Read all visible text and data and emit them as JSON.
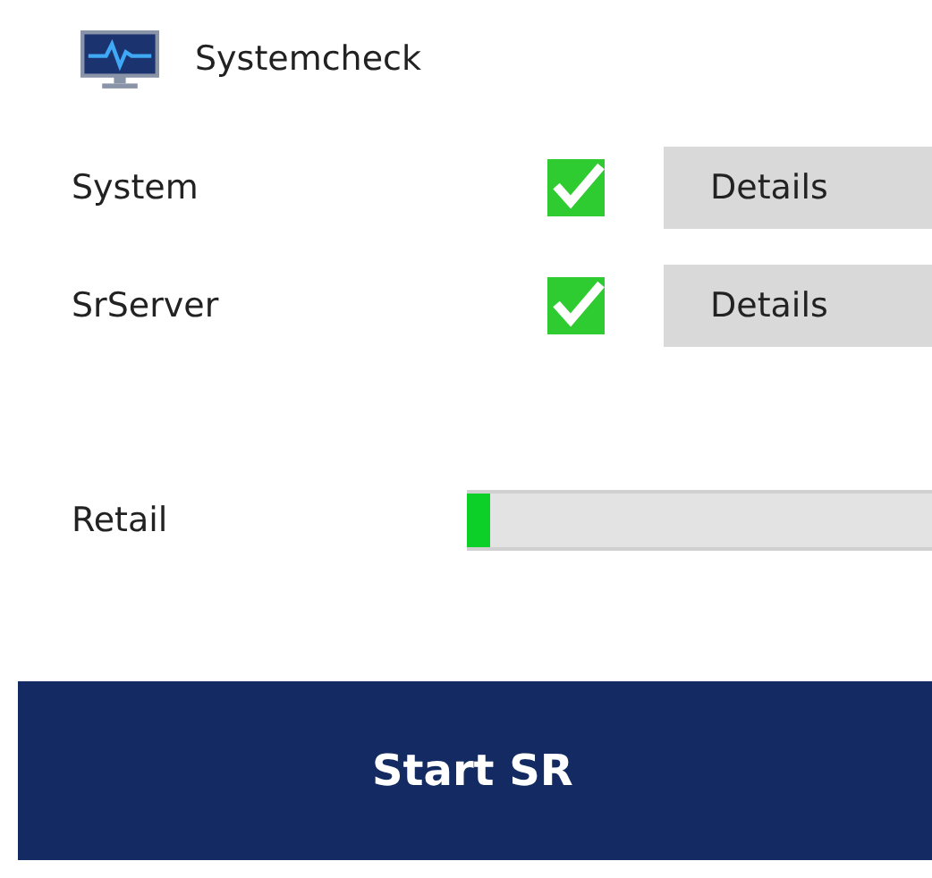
{
  "header": {
    "title": "Systemcheck"
  },
  "checks": [
    {
      "label": "System",
      "checked": true,
      "button": "Details"
    },
    {
      "label": "SrServer",
      "checked": true,
      "button": "Details"
    }
  ],
  "progress": {
    "label": "Retail",
    "level": 0.05
  },
  "start_button": "Start SR"
}
